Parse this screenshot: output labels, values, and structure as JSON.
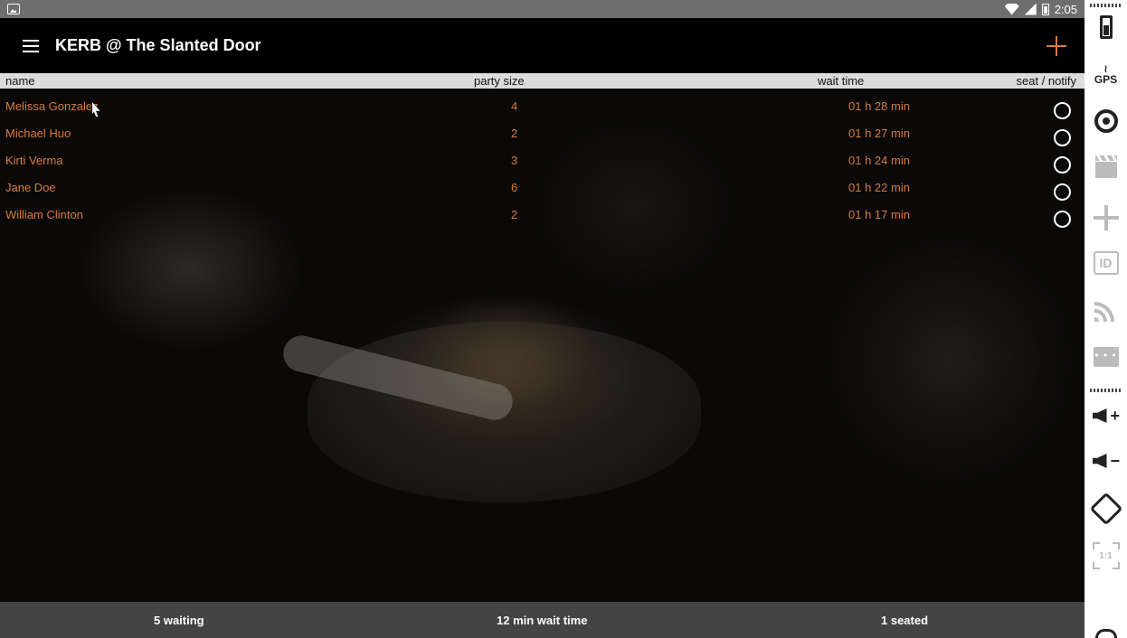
{
  "status_bar": {
    "time": "2:05",
    "left_icon": "gallery-icon",
    "right_icons": [
      "wifi-icon",
      "signal-icon",
      "battery-icon"
    ]
  },
  "app_bar": {
    "title": "KERB @ The Slanted Door",
    "menu_icon": "menu-icon",
    "action_icon": "add-icon",
    "accent_color": "#d77b3f"
  },
  "table": {
    "headers": {
      "name": "name",
      "party_size": "party size",
      "wait_time": "wait time",
      "seat_notify": "seat / notify"
    },
    "rows": [
      {
        "name": "Melissa Gonzalez",
        "party_size": "4",
        "wait_time": "01 h 28 min",
        "seated": false
      },
      {
        "name": "Michael Huo",
        "party_size": "2",
        "wait_time": "01 h 27 min",
        "seated": false
      },
      {
        "name": "Kirti Verma",
        "party_size": "3",
        "wait_time": "01 h 24 min",
        "seated": false
      },
      {
        "name": "Jane Doe",
        "party_size": "6",
        "wait_time": "01 h 22 min",
        "seated": false
      },
      {
        "name": "William Clinton",
        "party_size": "2",
        "wait_time": "01 h 17 min",
        "seated": false
      }
    ]
  },
  "footer": {
    "waiting": "5 waiting",
    "wait_time": "12 min wait time",
    "seated": "1 seated"
  },
  "emulator_toolbar": {
    "tools": [
      "battery-icon",
      "gps-icon",
      "camera-icon",
      "clapperboard-icon",
      "move-icon",
      "id-icon",
      "rss-icon",
      "chat-icon",
      "volume-up-icon",
      "volume-down-icon",
      "rotate-icon",
      "scale-icon",
      "back-icon"
    ],
    "gps_label": "GPS",
    "id_label": "ID",
    "scale_label": "1:1"
  }
}
